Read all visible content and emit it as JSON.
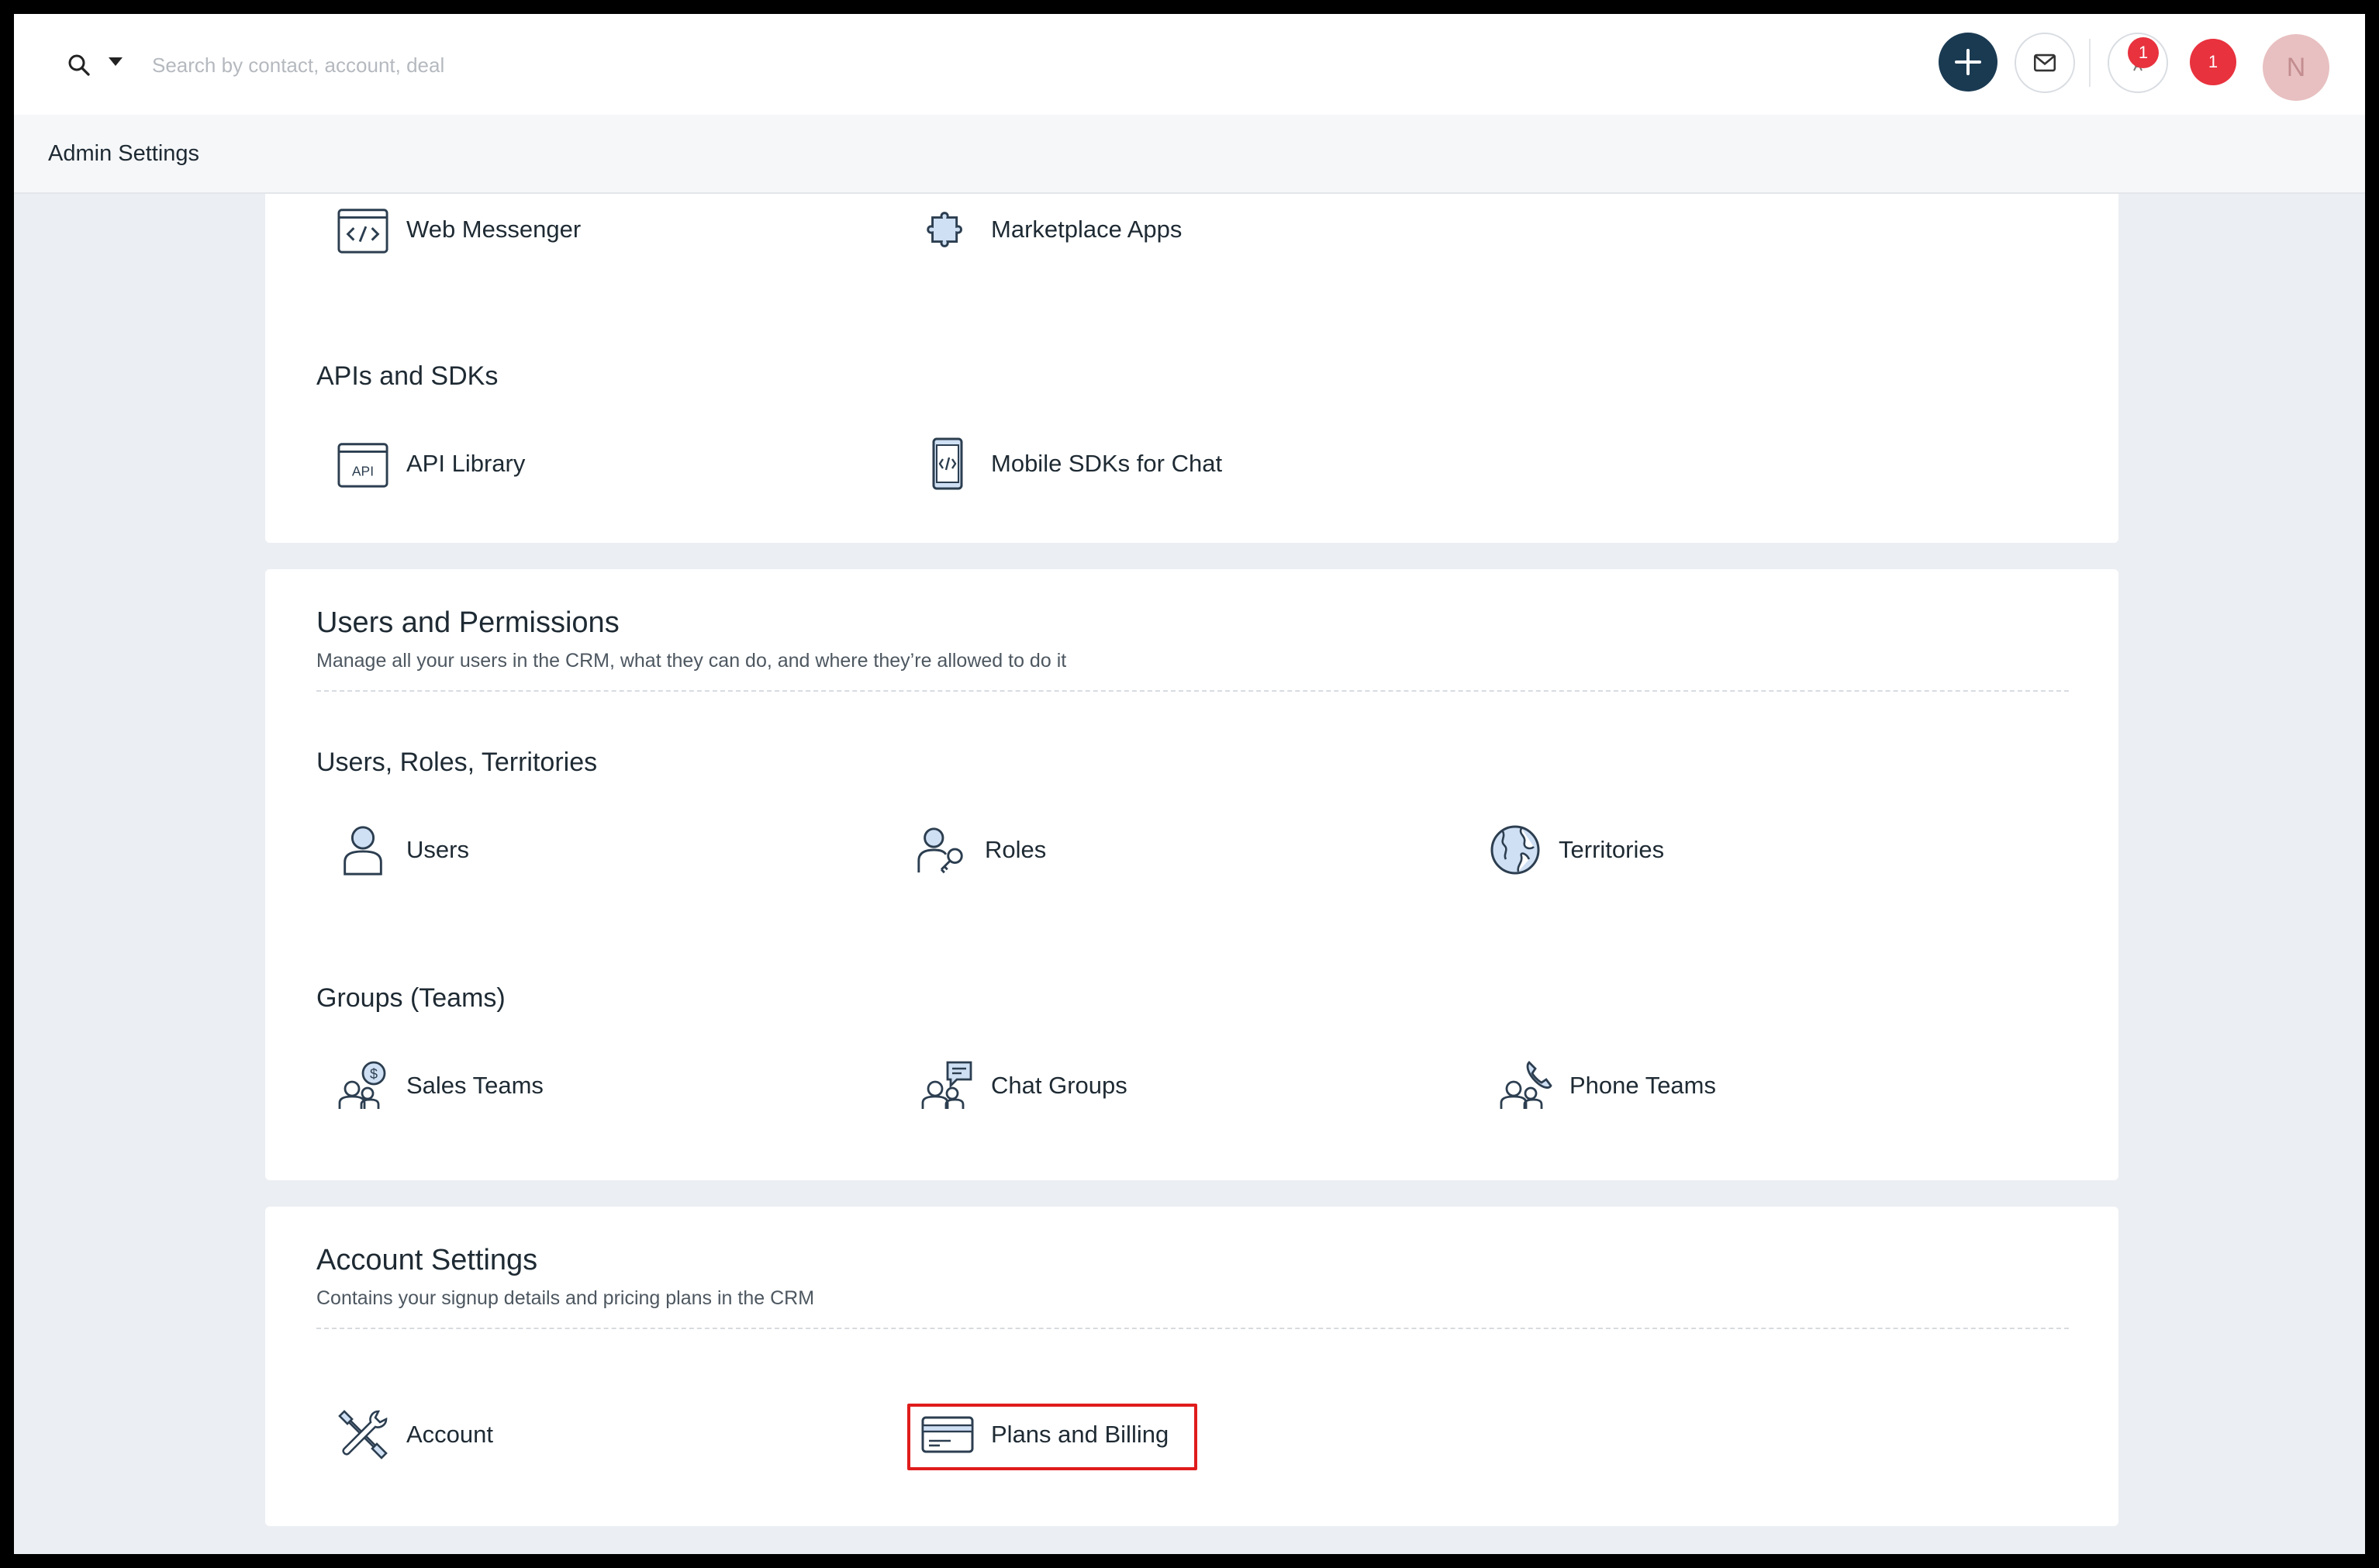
{
  "header": {
    "search_placeholder": "Search by contact, account, deal",
    "notification_count": "1",
    "alert_count": "1",
    "avatar_initial": "N"
  },
  "subheader": {
    "title": "Admin Settings"
  },
  "integrations": {
    "items": [
      {
        "label": "Web Messenger",
        "icon": "code-window-icon"
      },
      {
        "label": "Marketplace Apps",
        "icon": "puzzle-icon"
      }
    ],
    "apis_title": "APIs and SDKs",
    "api_items": [
      {
        "label": "API Library",
        "icon": "api-window-icon"
      },
      {
        "label": "Mobile SDKs for Chat",
        "icon": "mobile-code-icon"
      }
    ]
  },
  "users_permissions": {
    "title": "Users and Permissions",
    "description": "Manage all your users in the CRM, what they can do, and where they’re allowed to do it",
    "urt_title": "Users, Roles, Territories",
    "urt_items": [
      {
        "label": "Users",
        "icon": "user-icon"
      },
      {
        "label": "Roles",
        "icon": "user-key-icon"
      },
      {
        "label": "Territories",
        "icon": "globe-icon"
      }
    ],
    "groups_title": "Groups (Teams)",
    "group_items": [
      {
        "label": "Sales Teams",
        "icon": "sales-team-icon"
      },
      {
        "label": "Chat Groups",
        "icon": "chat-group-icon"
      },
      {
        "label": "Phone Teams",
        "icon": "phone-team-icon"
      }
    ]
  },
  "account_settings": {
    "title": "Account Settings",
    "description": "Contains your signup details and pricing plans in the CRM",
    "items": [
      {
        "label": "Account",
        "icon": "tools-icon"
      },
      {
        "label": "Plans and Billing",
        "icon": "credit-card-icon",
        "highlighted": true
      }
    ]
  },
  "colors": {
    "accent_dark": "#1a3a52",
    "badge_red": "#e8323e",
    "highlight_red": "#e01c1c",
    "icon_fill": "#cfe0f4"
  }
}
